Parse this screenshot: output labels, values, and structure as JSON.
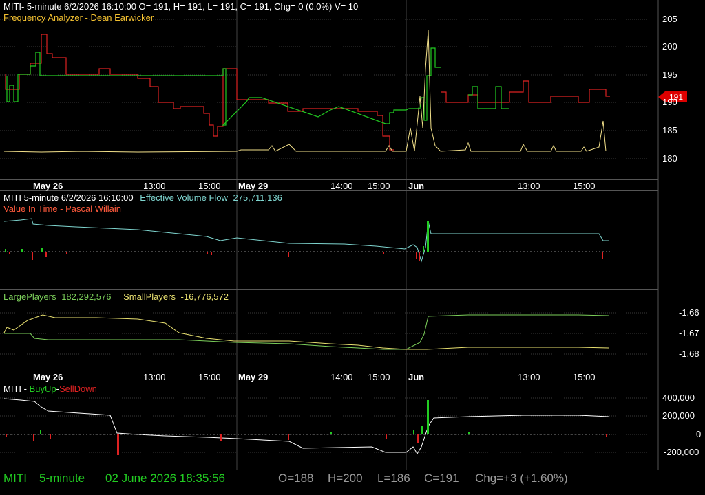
{
  "pane1": {
    "header": "MITI- 5-minute 6/2/2026 16:10:00 O= 191, H= 191, L= 191, C= 191, Chg= 0 (0.0%) V= 10",
    "study": "Frequency Analyzer - Dean Earwicker",
    "y_ticks": [
      "205",
      "200",
      "195",
      "190",
      "185",
      "180"
    ],
    "last_price": "191"
  },
  "time_axis": {
    "labels": [
      "May 26",
      "13:00",
      "15:00",
      "May 29",
      "14:00",
      "15:00",
      "Jun",
      "13:00",
      "15:00"
    ]
  },
  "pane2": {
    "header": "MITI 5-minute  6/2/2026 16:10:00",
    "evf": "Effective Volume Flow=275,711,136",
    "study": "Value In Time - Pascal Willain"
  },
  "pane3": {
    "large": "LargePlayers=182,292,576",
    "small": "SmallPlayers=-16,776,572",
    "y_ticks": [
      "-1.66",
      "-1.67",
      "-1.68"
    ]
  },
  "pane4": {
    "prefix": "MITI -",
    "buy": "BuyUp",
    "sep": "-",
    "sell": "SellDown",
    "y_ticks": [
      "400,000",
      "200,000",
      "0",
      "-200,000"
    ]
  },
  "status": {
    "symbol": "MITI",
    "interval": "5-minute",
    "datetime": "02 June 2026 18:35:56",
    "open": "O=188",
    "high": "H=200",
    "low": "L=186",
    "close": "C=191",
    "change": "Chg=+3 (+1.60%)"
  },
  "colors": {
    "up": "#22cc22",
    "down": "#dd2222",
    "freq": "#f2e08a",
    "evf": "#7fd6d0",
    "large": "#7ccf5a",
    "small": "#e8e070",
    "value_in_time": "#ff5a3c",
    "status_green": "#22cc22",
    "status_grey": "#9a9a9a"
  }
}
